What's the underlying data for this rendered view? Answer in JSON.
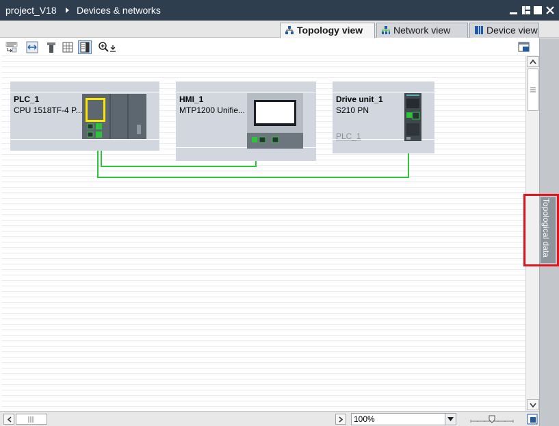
{
  "window": {
    "project": "project_V18",
    "title": "Devices & networks"
  },
  "tabs": [
    {
      "label": "Topology view",
      "icon": "topology-icon",
      "active": true
    },
    {
      "label": "Network view",
      "icon": "network-icon",
      "active": false
    },
    {
      "label": "Device view",
      "icon": "device-icon",
      "active": false
    }
  ],
  "devices": [
    {
      "name": "PLC_1",
      "type": "CPU 1518TF-4 P...",
      "sub": ""
    },
    {
      "name": "HMI_1",
      "type": "MTP1200  Unifie...",
      "sub": ""
    },
    {
      "name": "Drive unit_1",
      "type": "S210 PN",
      "sub": "PLC_1"
    }
  ],
  "side_panel": {
    "label": "Topological data"
  },
  "zoom": {
    "value": "100%"
  },
  "colors": {
    "titlebar": "#2f3e4e",
    "connection": "#2ec43a",
    "highlight": "#e0141e",
    "device_box": "#d2d6df"
  }
}
